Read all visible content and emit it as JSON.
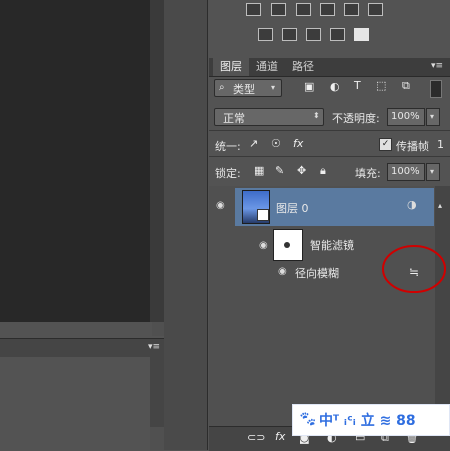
{
  "layers_panel": {
    "tabs": [
      {
        "label": "图层"
      },
      {
        "label": "通道"
      },
      {
        "label": "路径"
      }
    ],
    "filter": {
      "icon": "search-icon",
      "label": "类型"
    },
    "blend_mode": "正常",
    "opacity_label": "不透明度:",
    "opacity_value": "100%",
    "unify_label": "统一:",
    "propagate_label": "传播帧",
    "propagate_value": "1",
    "lock_label": "锁定:",
    "fill_label": "填充:",
    "fill_value": "100%",
    "layers": [
      {
        "name": "图层 0"
      },
      {
        "name": "智能滤镜"
      },
      {
        "name": "径向模糊"
      }
    ]
  },
  "watermark": {
    "text": "中ᵀ ᵢᶜᵢ 立 ≋ 88"
  },
  "annotation_color": "#d00000",
  "accent_color": "#5a7aa0"
}
